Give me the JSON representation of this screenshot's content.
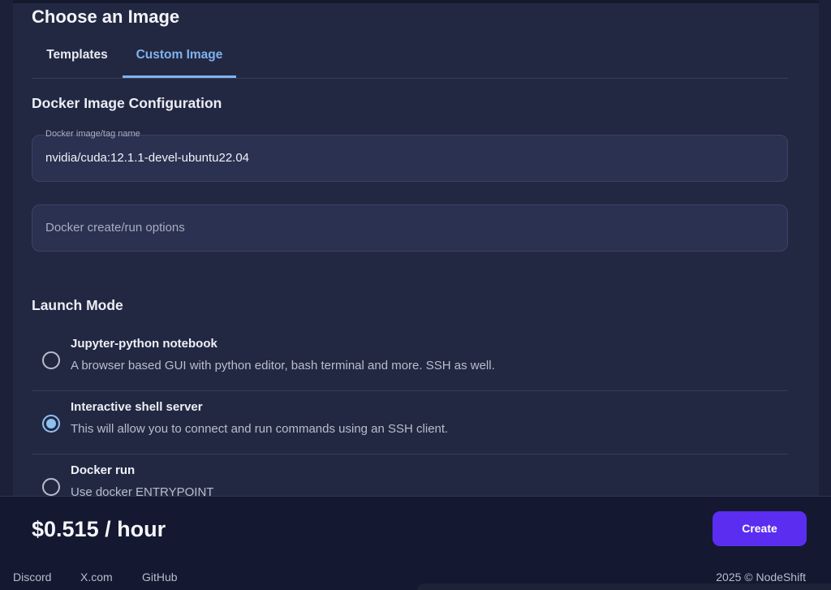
{
  "panel": {
    "title": "Choose an Image"
  },
  "tabs": [
    {
      "label": "Templates",
      "active": false
    },
    {
      "label": "Custom Image",
      "active": true
    }
  ],
  "docker_config": {
    "title": "Docker Image Configuration",
    "image_field": {
      "label": "Docker image/tag name",
      "value": "nvidia/cuda:12.1.1-devel-ubuntu22.04"
    },
    "options_field": {
      "placeholder": "Docker create/run options",
      "value": ""
    }
  },
  "launch_mode": {
    "title": "Launch Mode",
    "options": [
      {
        "title": "Jupyter-python notebook",
        "description": "A browser based GUI with python editor, bash terminal and more. SSH as well.",
        "selected": false
      },
      {
        "title": "Interactive shell server",
        "description": "This will allow you to connect and run commands using an SSH client.",
        "selected": true
      },
      {
        "title": "Docker run",
        "description": "Use docker ENTRYPOINT",
        "selected": false
      }
    ]
  },
  "footer": {
    "price": "$0.515 / hour",
    "create_label": "Create",
    "links": [
      "Discord",
      "X.com",
      "GitHub"
    ],
    "copyright": "2025 © NodeShift"
  },
  "colors": {
    "accent": "#5a2df0",
    "active_tab": "#7fb3ee",
    "radio_checked": "#8ec0f2"
  }
}
